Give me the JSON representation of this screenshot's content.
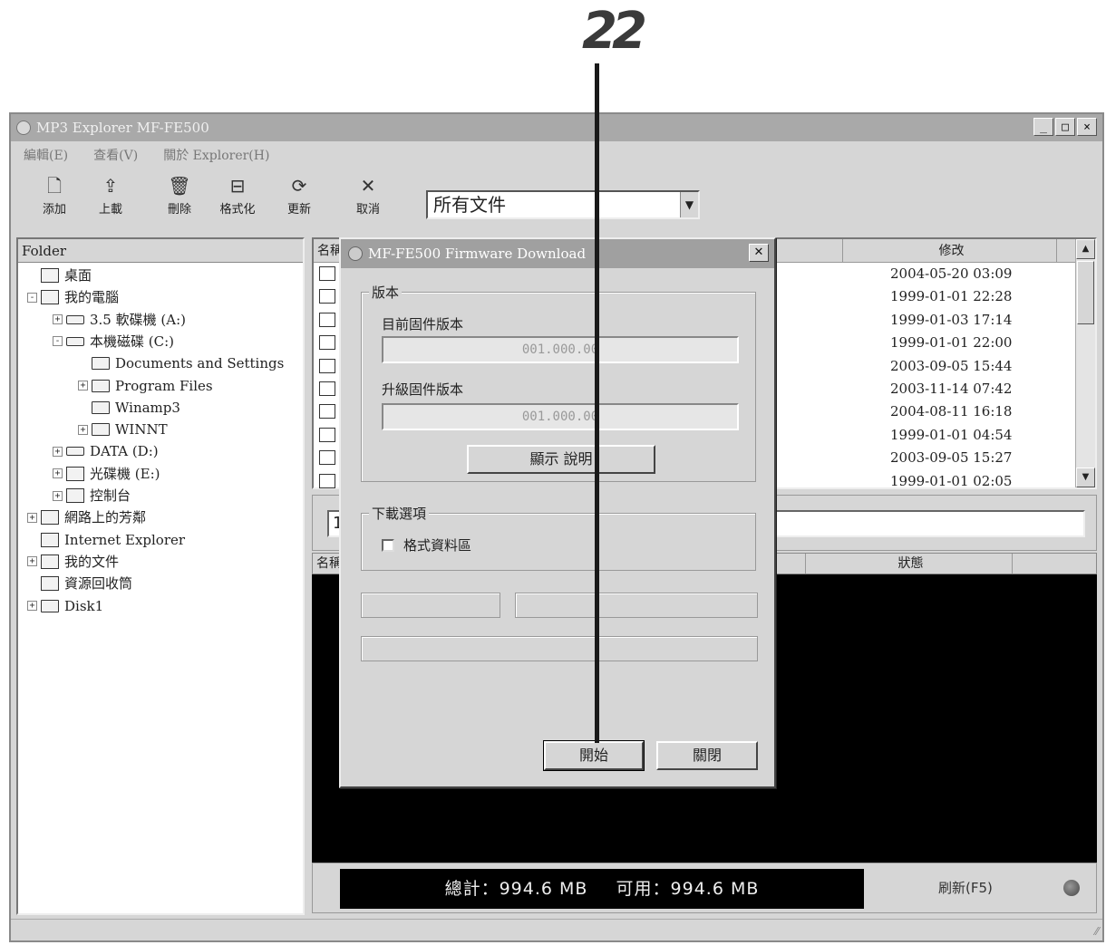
{
  "callout": {
    "step": "22"
  },
  "window": {
    "title": "MP3 Explorer MF-FE500",
    "controls": [
      "_",
      "□",
      "×"
    ]
  },
  "menu": [
    "編輯(E)",
    "查看(V)",
    "關於 Explorer(H)"
  ],
  "toolbar": {
    "buttons": [
      {
        "label": "添加",
        "icon": "add-file-icon"
      },
      {
        "label": "上載",
        "icon": "upload-icon"
      },
      {
        "label": "刪除",
        "icon": "trash-icon"
      },
      {
        "label": "格式化",
        "icon": "format-disk-icon"
      },
      {
        "label": "更新",
        "icon": "update-icon"
      },
      {
        "label": "取消",
        "icon": "cancel-icon"
      }
    ],
    "filter_value": "所有文件"
  },
  "folder_pane": {
    "header": "Folder",
    "items": [
      {
        "label": "桌面",
        "level": 1,
        "expander": "",
        "icon": "desktop-icon"
      },
      {
        "label": "我的電腦",
        "level": 1,
        "expander": "-",
        "icon": "computer-icon"
      },
      {
        "label": "3.5 軟碟機 (A:)",
        "level": 2,
        "expander": "+",
        "icon": "floppy-icon"
      },
      {
        "label": "本機磁碟 (C:)",
        "level": 2,
        "expander": "-",
        "icon": "drive-icon"
      },
      {
        "label": "Documents and Settings",
        "level": 3,
        "expander": "",
        "icon": "folder-icon"
      },
      {
        "label": "Program Files",
        "level": 3,
        "expander": "+",
        "icon": "folder-icon"
      },
      {
        "label": "Winamp3",
        "level": 3,
        "expander": "",
        "icon": "folder-icon"
      },
      {
        "label": "WINNT",
        "level": 3,
        "expander": "+",
        "icon": "folder-icon"
      },
      {
        "label": "DATA (D:)",
        "level": 2,
        "expander": "+",
        "icon": "drive-icon"
      },
      {
        "label": "光碟機 (E:)",
        "level": 2,
        "expander": "+",
        "icon": "cd-icon"
      },
      {
        "label": "控制台",
        "level": 2,
        "expander": "+",
        "icon": "control-panel-icon"
      },
      {
        "label": "網路上的芳鄰",
        "level": 1,
        "expander": "+",
        "icon": "network-icon"
      },
      {
        "label": "Internet Explorer",
        "level": 1,
        "expander": "",
        "icon": "ie-icon"
      },
      {
        "label": "我的文件",
        "level": 1,
        "expander": "+",
        "icon": "documents-icon"
      },
      {
        "label": "資源回收筒",
        "level": 1,
        "expander": "",
        "icon": "recycle-bin-icon"
      },
      {
        "label": "Disk1",
        "level": 1,
        "expander": "+",
        "icon": "folder-icon"
      }
    ]
  },
  "file_list": {
    "columns": [
      "名稱",
      "修改"
    ],
    "rows": [
      "2004-05-20 03:09",
      "1999-01-01 22:28",
      "1999-01-03 17:14",
      "1999-01-01 22:00",
      "2003-09-05 15:44",
      "2003-11-14 07:42",
      "2004-08-11 16:18",
      "1999-01-01 04:54",
      "2003-09-05 15:27",
      "1999-01-01 02:05"
    ]
  },
  "path_bar": {
    "value": "1"
  },
  "transfer_list": {
    "columns": [
      "名稱",
      "狀態"
    ]
  },
  "status": {
    "total": "總計：994.6 MB",
    "available": "可用：994.6 MB",
    "refresh": "刷新(F5)"
  },
  "dialog": {
    "title": "MF-FE500 Firmware Download",
    "version_group": "版本",
    "current_label": "目前固件版本",
    "current_value": "001.000.00",
    "upgrade_label": "升級固件版本",
    "upgrade_value": "001.000.00",
    "show_info_button": "顯示 說明",
    "options_group": "下載選項",
    "format_checkbox": "格式資料區",
    "format_checked": false,
    "start_button": "開始",
    "close_button": "關閉"
  }
}
